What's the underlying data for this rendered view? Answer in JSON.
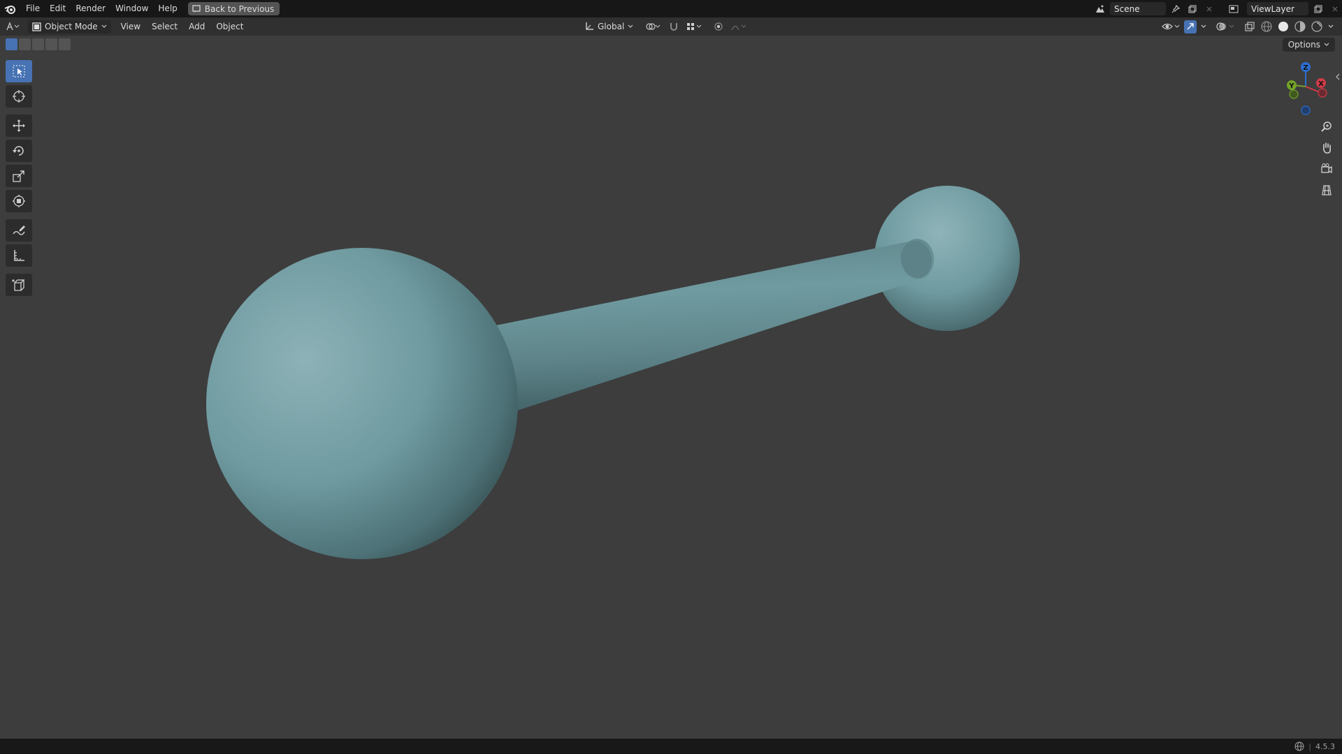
{
  "topbar": {
    "menus": [
      "File",
      "Edit",
      "Render",
      "Window",
      "Help"
    ],
    "back_button": "Back to Previous",
    "scene_name": "Scene",
    "view_layer": "ViewLayer"
  },
  "header": {
    "mode": "Object Mode",
    "menus": [
      "View",
      "Select",
      "Add",
      "Object"
    ],
    "transform_orientation": "Global",
    "options_label": "Options"
  },
  "gizmo": {
    "z": "Z",
    "y": "Y",
    "x": "X"
  },
  "statusbar": {
    "version": "4.5.3"
  },
  "colors": {
    "object": "#6e9aa0",
    "active_tool": "#4772b3",
    "background": "#3d3d3d"
  }
}
